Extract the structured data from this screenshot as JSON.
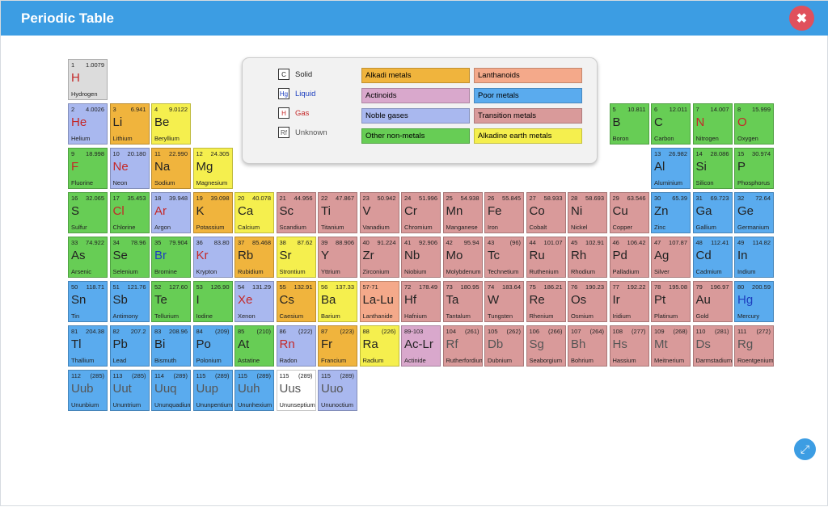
{
  "window": {
    "title": "Periodic Table",
    "close_icon": "✖",
    "expand_icon": "⤢"
  },
  "colors": {
    "alkali": "#f0b43d",
    "alkaline": "#f5ef4e",
    "transition": "#d99a9a",
    "poor": "#5aabee",
    "nonmetal": "#67cd55",
    "noble": "#a9b8ef",
    "lanthanoid": "#f4a98a",
    "actinoid": "#d9a8cc",
    "unknown": "#ffffff",
    "hydrogen": "#dcdcdc",
    "solid_text": "#222222",
    "liquid_text": "#1d3fbf",
    "gas_text": "#c42828",
    "unknown_text": "#555555"
  },
  "legend": {
    "states": [
      {
        "box": "C",
        "label": "Solid",
        "state": "solid"
      },
      {
        "box": "Hg",
        "label": "Liquid",
        "state": "liquid"
      },
      {
        "box": "H",
        "label": "Gas",
        "state": "gas"
      },
      {
        "box": "Rf",
        "label": "Unknown",
        "state": "unknown"
      }
    ],
    "categories": [
      {
        "label": "Alkadi metals",
        "cat": "alkali"
      },
      {
        "label": "Lanthanoids",
        "cat": "lanthanoid"
      },
      {
        "label": "Actinoids",
        "cat": "actinoid"
      },
      {
        "label": "Poor metals",
        "cat": "poor"
      },
      {
        "label": "Noble gases",
        "cat": "noble"
      },
      {
        "label": "Transition metals",
        "cat": "transition"
      },
      {
        "label": "Other non-metals",
        "cat": "nonmetal"
      },
      {
        "label": "Alkadine earth metals",
        "cat": "alkaline"
      }
    ]
  },
  "elements": [
    {
      "n": "1",
      "m": "1.0079",
      "s": "H",
      "name": "Hydrogen",
      "cat": "hydrogen",
      "st": "gas",
      "r": 0,
      "c": 0
    },
    {
      "n": "2",
      "m": "4.0026",
      "s": "He",
      "name": "Helium",
      "cat": "noble",
      "st": "gas",
      "r": 1,
      "c": 0
    },
    {
      "n": "3",
      "m": "6.941",
      "s": "Li",
      "name": "Lithium",
      "cat": "alkali",
      "st": "solid",
      "r": 1,
      "c": 1
    },
    {
      "n": "4",
      "m": "9.0122",
      "s": "Be",
      "name": "Beryllium",
      "cat": "alkaline",
      "st": "solid",
      "r": 1,
      "c": 2
    },
    {
      "n": "5",
      "m": "10.811",
      "s": "B",
      "name": "Boron",
      "cat": "nonmetal",
      "st": "solid",
      "r": 1,
      "c": 13
    },
    {
      "n": "6",
      "m": "12.011",
      "s": "C",
      "name": "Carbon",
      "cat": "nonmetal",
      "st": "solid",
      "r": 1,
      "c": 14
    },
    {
      "n": "7",
      "m": "14.007",
      "s": "N",
      "name": "Nitrogen",
      "cat": "nonmetal",
      "st": "gas",
      "r": 1,
      "c": 15
    },
    {
      "n": "8",
      "m": "15.999",
      "s": "O",
      "name": "Oxygen",
      "cat": "nonmetal",
      "st": "gas",
      "r": 1,
      "c": 16
    },
    {
      "n": "9",
      "m": "18.998",
      "s": "F",
      "name": "Fluorine",
      "cat": "nonmetal",
      "st": "gas",
      "r": 2,
      "c": 0
    },
    {
      "n": "10",
      "m": "20.180",
      "s": "Ne",
      "name": "Neon",
      "cat": "noble",
      "st": "gas",
      "r": 2,
      "c": 1
    },
    {
      "n": "11",
      "m": "22.990",
      "s": "Na",
      "name": "Sodium",
      "cat": "alkali",
      "st": "solid",
      "r": 2,
      "c": 2
    },
    {
      "n": "12",
      "m": "24.305",
      "s": "Mg",
      "name": "Magnesium",
      "cat": "alkaline",
      "st": "solid",
      "r": 2,
      "c": 3
    },
    {
      "n": "13",
      "m": "26.982",
      "s": "Al",
      "name": "Aluminium",
      "cat": "poor",
      "st": "solid",
      "r": 2,
      "c": 14
    },
    {
      "n": "14",
      "m": "28.086",
      "s": "Si",
      "name": "Silicon",
      "cat": "nonmetal",
      "st": "solid",
      "r": 2,
      "c": 15
    },
    {
      "n": "15",
      "m": "30.974",
      "s": "P",
      "name": "Phosphorus",
      "cat": "nonmetal",
      "st": "solid",
      "r": 2,
      "c": 16
    },
    {
      "n": "16",
      "m": "32.065",
      "s": "S",
      "name": "Sulfur",
      "cat": "nonmetal",
      "st": "solid",
      "r": 3,
      "c": 0
    },
    {
      "n": "17",
      "m": "35.453",
      "s": "Cl",
      "name": "Chlorine",
      "cat": "nonmetal",
      "st": "gas",
      "r": 3,
      "c": 1
    },
    {
      "n": "18",
      "m": "39.948",
      "s": "Ar",
      "name": "Argon",
      "cat": "noble",
      "st": "gas",
      "r": 3,
      "c": 2
    },
    {
      "n": "19",
      "m": "39.098",
      "s": "K",
      "name": "Potassium",
      "cat": "alkali",
      "st": "solid",
      "r": 3,
      "c": 3
    },
    {
      "n": "20",
      "m": "40.078",
      "s": "Ca",
      "name": "Calcium",
      "cat": "alkaline",
      "st": "solid",
      "r": 3,
      "c": 4
    },
    {
      "n": "21",
      "m": "44.956",
      "s": "Sc",
      "name": "Scandium",
      "cat": "transition",
      "st": "solid",
      "r": 3,
      "c": 5
    },
    {
      "n": "22",
      "m": "47.867",
      "s": "Ti",
      "name": "Titanium",
      "cat": "transition",
      "st": "solid",
      "r": 3,
      "c": 6
    },
    {
      "n": "23",
      "m": "50.942",
      "s": "V",
      "name": "Vanadium",
      "cat": "transition",
      "st": "solid",
      "r": 3,
      "c": 7
    },
    {
      "n": "24",
      "m": "51.996",
      "s": "Cr",
      "name": "Chromium",
      "cat": "transition",
      "st": "solid",
      "r": 3,
      "c": 8
    },
    {
      "n": "25",
      "m": "54.938",
      "s": "Mn",
      "name": "Manganese",
      "cat": "transition",
      "st": "solid",
      "r": 3,
      "c": 9
    },
    {
      "n": "26",
      "m": "55.845",
      "s": "Fe",
      "name": "Iron",
      "cat": "transition",
      "st": "solid",
      "r": 3,
      "c": 10
    },
    {
      "n": "27",
      "m": "58.933",
      "s": "Co",
      "name": "Cobalt",
      "cat": "transition",
      "st": "solid",
      "r": 3,
      "c": 11
    },
    {
      "n": "28",
      "m": "58.693",
      "s": "Ni",
      "name": "Nickel",
      "cat": "transition",
      "st": "solid",
      "r": 3,
      "c": 12
    },
    {
      "n": "29",
      "m": "63.546",
      "s": "Cu",
      "name": "Copper",
      "cat": "transition",
      "st": "solid",
      "r": 3,
      "c": 13
    },
    {
      "n": "30",
      "m": "65.39",
      "s": "Zn",
      "name": "Zinc",
      "cat": "poor",
      "st": "solid",
      "r": 3,
      "c": 14
    },
    {
      "n": "31",
      "m": "69.723",
      "s": "Ga",
      "name": "Gallium",
      "cat": "poor",
      "st": "solid",
      "r": 3,
      "c": 15
    },
    {
      "n": "32",
      "m": "72.64",
      "s": "Ge",
      "name": "Germanium",
      "cat": "poor",
      "st": "solid",
      "r": 3,
      "c": 16
    },
    {
      "n": "33",
      "m": "74.922",
      "s": "As",
      "name": "Arsenic",
      "cat": "nonmetal",
      "st": "solid",
      "r": 4,
      "c": 0
    },
    {
      "n": "34",
      "m": "78.96",
      "s": "Se",
      "name": "Selenium",
      "cat": "nonmetal",
      "st": "solid",
      "r": 4,
      "c": 1
    },
    {
      "n": "35",
      "m": "79.904",
      "s": "Br",
      "name": "Bromine",
      "cat": "nonmetal",
      "st": "liquid",
      "r": 4,
      "c": 2
    },
    {
      "n": "36",
      "m": "83.80",
      "s": "Kr",
      "name": "Krypton",
      "cat": "noble",
      "st": "gas",
      "r": 4,
      "c": 3
    },
    {
      "n": "37",
      "m": "85.468",
      "s": "Rb",
      "name": "Rubidium",
      "cat": "alkali",
      "st": "solid",
      "r": 4,
      "c": 4
    },
    {
      "n": "38",
      "m": "87.62",
      "s": "Sr",
      "name": "Strontium",
      "cat": "alkaline",
      "st": "solid",
      "r": 4,
      "c": 5
    },
    {
      "n": "39",
      "m": "88.906",
      "s": "Y",
      "name": "Yttrium",
      "cat": "transition",
      "st": "solid",
      "r": 4,
      "c": 6
    },
    {
      "n": "40",
      "m": "91.224",
      "s": "Zr",
      "name": "Zirconium",
      "cat": "transition",
      "st": "solid",
      "r": 4,
      "c": 7
    },
    {
      "n": "41",
      "m": "92.906",
      "s": "Nb",
      "name": "Niobium",
      "cat": "transition",
      "st": "solid",
      "r": 4,
      "c": 8
    },
    {
      "n": "42",
      "m": "95.94",
      "s": "Mo",
      "name": "Molybdenum",
      "cat": "transition",
      "st": "solid",
      "r": 4,
      "c": 9
    },
    {
      "n": "43",
      "m": "(96)",
      "s": "Tc",
      "name": "Technetium",
      "cat": "transition",
      "st": "solid",
      "r": 4,
      "c": 10
    },
    {
      "n": "44",
      "m": "101.07",
      "s": "Ru",
      "name": "Ruthenium",
      "cat": "transition",
      "st": "solid",
      "r": 4,
      "c": 11
    },
    {
      "n": "45",
      "m": "102.91",
      "s": "Rh",
      "name": "Rhodium",
      "cat": "transition",
      "st": "solid",
      "r": 4,
      "c": 12
    },
    {
      "n": "46",
      "m": "106.42",
      "s": "Pd",
      "name": "Palladium",
      "cat": "transition",
      "st": "solid",
      "r": 4,
      "c": 13
    },
    {
      "n": "47",
      "m": "107.87",
      "s": "Ag",
      "name": "Silver",
      "cat": "transition",
      "st": "solid",
      "r": 4,
      "c": 14
    },
    {
      "n": "48",
      "m": "112.41",
      "s": "Cd",
      "name": "Cadmium",
      "cat": "poor",
      "st": "solid",
      "r": 4,
      "c": 15
    },
    {
      "n": "49",
      "m": "114.82",
      "s": "In",
      "name": "Indium",
      "cat": "poor",
      "st": "solid",
      "r": 4,
      "c": 16
    },
    {
      "n": "50",
      "m": "118.71",
      "s": "Sn",
      "name": "Tin",
      "cat": "poor",
      "st": "solid",
      "r": 5,
      "c": 0
    },
    {
      "n": "51",
      "m": "121.76",
      "s": "Sb",
      "name": "Antimony",
      "cat": "poor",
      "st": "solid",
      "r": 5,
      "c": 1
    },
    {
      "n": "52",
      "m": "127.60",
      "s": "Te",
      "name": "Tellurium",
      "cat": "nonmetal",
      "st": "solid",
      "r": 5,
      "c": 2
    },
    {
      "n": "53",
      "m": "126.90",
      "s": "I",
      "name": "Iodine",
      "cat": "nonmetal",
      "st": "solid",
      "r": 5,
      "c": 3
    },
    {
      "n": "54",
      "m": "131.29",
      "s": "Xe",
      "name": "Xenon",
      "cat": "noble",
      "st": "gas",
      "r": 5,
      "c": 4
    },
    {
      "n": "55",
      "m": "132.91",
      "s": "Cs",
      "name": "Caesium",
      "cat": "alkali",
      "st": "solid",
      "r": 5,
      "c": 5
    },
    {
      "n": "56",
      "m": "137.33",
      "s": "Ba",
      "name": "Barium",
      "cat": "alkaline",
      "st": "solid",
      "r": 5,
      "c": 6
    },
    {
      "n": "57-71",
      "m": "",
      "s": "La-Lu",
      "name": "Lanthanide",
      "cat": "lanthanoid",
      "st": "solid",
      "r": 5,
      "c": 7
    },
    {
      "n": "72",
      "m": "178.49",
      "s": "Hf",
      "name": "Hafnium",
      "cat": "transition",
      "st": "solid",
      "r": 5,
      "c": 8
    },
    {
      "n": "73",
      "m": "180.95",
      "s": "Ta",
      "name": "Tantalum",
      "cat": "transition",
      "st": "solid",
      "r": 5,
      "c": 9
    },
    {
      "n": "74",
      "m": "183.64",
      "s": "W",
      "name": "Tungsten",
      "cat": "transition",
      "st": "solid",
      "r": 5,
      "c": 10
    },
    {
      "n": "75",
      "m": "186.21",
      "s": "Re",
      "name": "Rhenium",
      "cat": "transition",
      "st": "solid",
      "r": 5,
      "c": 11
    },
    {
      "n": "76",
      "m": "190.23",
      "s": "Os",
      "name": "Osmium",
      "cat": "transition",
      "st": "solid",
      "r": 5,
      "c": 12
    },
    {
      "n": "77",
      "m": "192.22",
      "s": "Ir",
      "name": "Iridium",
      "cat": "transition",
      "st": "solid",
      "r": 5,
      "c": 13
    },
    {
      "n": "78",
      "m": "195.08",
      "s": "Pt",
      "name": "Platinum",
      "cat": "transition",
      "st": "solid",
      "r": 5,
      "c": 14
    },
    {
      "n": "79",
      "m": "196.97",
      "s": "Au",
      "name": "Gold",
      "cat": "transition",
      "st": "solid",
      "r": 5,
      "c": 15
    },
    {
      "n": "80",
      "m": "200.59",
      "s": "Hg",
      "name": "Mercury",
      "cat": "poor",
      "st": "liquid",
      "r": 5,
      "c": 16
    },
    {
      "n": "81",
      "m": "204.38",
      "s": "Tl",
      "name": "Thallium",
      "cat": "poor",
      "st": "solid",
      "r": 6,
      "c": 0
    },
    {
      "n": "82",
      "m": "207.2",
      "s": "Pb",
      "name": "Lead",
      "cat": "poor",
      "st": "solid",
      "r": 6,
      "c": 1
    },
    {
      "n": "83",
      "m": "208.96",
      "s": "Bi",
      "name": "Bismuth",
      "cat": "poor",
      "st": "solid",
      "r": 6,
      "c": 2
    },
    {
      "n": "84",
      "m": "(209)",
      "s": "Po",
      "name": "Polonium",
      "cat": "poor",
      "st": "solid",
      "r": 6,
      "c": 3
    },
    {
      "n": "85",
      "m": "(210)",
      "s": "At",
      "name": "Astatine",
      "cat": "nonmetal",
      "st": "solid",
      "r": 6,
      "c": 4
    },
    {
      "n": "86",
      "m": "(222)",
      "s": "Rn",
      "name": "Radon",
      "cat": "noble",
      "st": "gas",
      "r": 6,
      "c": 5
    },
    {
      "n": "87",
      "m": "(223)",
      "s": "Fr",
      "name": "Francium",
      "cat": "alkali",
      "st": "solid",
      "r": 6,
      "c": 6
    },
    {
      "n": "88",
      "m": "(226)",
      "s": "Ra",
      "name": "Radium",
      "cat": "alkaline",
      "st": "solid",
      "r": 6,
      "c": 7
    },
    {
      "n": "89-103",
      "m": "",
      "s": "Ac-Lr",
      "name": "Actinide",
      "cat": "actinoid",
      "st": "solid",
      "r": 6,
      "c": 8
    },
    {
      "n": "104",
      "m": "(261)",
      "s": "Rf",
      "name": "Rutherfordium",
      "cat": "transition",
      "st": "unknown",
      "r": 6,
      "c": 9
    },
    {
      "n": "105",
      "m": "(262)",
      "s": "Db",
      "name": "Dubnium",
      "cat": "transition",
      "st": "unknown",
      "r": 6,
      "c": 10
    },
    {
      "n": "106",
      "m": "(266)",
      "s": "Sg",
      "name": "Seaborgium",
      "cat": "transition",
      "st": "unknown",
      "r": 6,
      "c": 11
    },
    {
      "n": "107",
      "m": "(264)",
      "s": "Bh",
      "name": "Bohrium",
      "cat": "transition",
      "st": "unknown",
      "r": 6,
      "c": 12
    },
    {
      "n": "108",
      "m": "(277)",
      "s": "Hs",
      "name": "Hassium",
      "cat": "transition",
      "st": "unknown",
      "r": 6,
      "c": 13
    },
    {
      "n": "109",
      "m": "(268)",
      "s": "Mt",
      "name": "Meitnerium",
      "cat": "transition",
      "st": "unknown",
      "r": 6,
      "c": 14
    },
    {
      "n": "110",
      "m": "(281)",
      "s": "Ds",
      "name": "Darmstadium",
      "cat": "transition",
      "st": "unknown",
      "r": 6,
      "c": 15
    },
    {
      "n": "111",
      "m": "(272)",
      "s": "Rg",
      "name": "Roentgenium",
      "cat": "transition",
      "st": "unknown",
      "r": 6,
      "c": 16
    },
    {
      "n": "112",
      "m": "(285)",
      "s": "Uub",
      "name": "Ununbium",
      "cat": "poor",
      "st": "unknown",
      "r": 7,
      "c": 0
    },
    {
      "n": "113",
      "m": "(285)",
      "s": "Uut",
      "name": "Ununtrium",
      "cat": "poor",
      "st": "unknown",
      "r": 7,
      "c": 1
    },
    {
      "n": "114",
      "m": "(289)",
      "s": "Uuq",
      "name": "Ununquadium",
      "cat": "poor",
      "st": "unknown",
      "r": 7,
      "c": 2
    },
    {
      "n": "115",
      "m": "(289)",
      "s": "Uup",
      "name": "Ununpentium",
      "cat": "poor",
      "st": "unknown",
      "r": 7,
      "c": 3
    },
    {
      "n": "115",
      "m": "(289)",
      "s": "Uuh",
      "name": "Ununhexium",
      "cat": "poor",
      "st": "unknown",
      "r": 7,
      "c": 4
    },
    {
      "n": "115",
      "m": "(289)",
      "s": "Uus",
      "name": "Ununseptium",
      "cat": "unknown",
      "st": "unknown",
      "r": 7,
      "c": 5
    },
    {
      "n": "115",
      "m": "(289)",
      "s": "Uuo",
      "name": "Ununoctium",
      "cat": "noble",
      "st": "unknown",
      "r": 7,
      "c": 6
    }
  ]
}
